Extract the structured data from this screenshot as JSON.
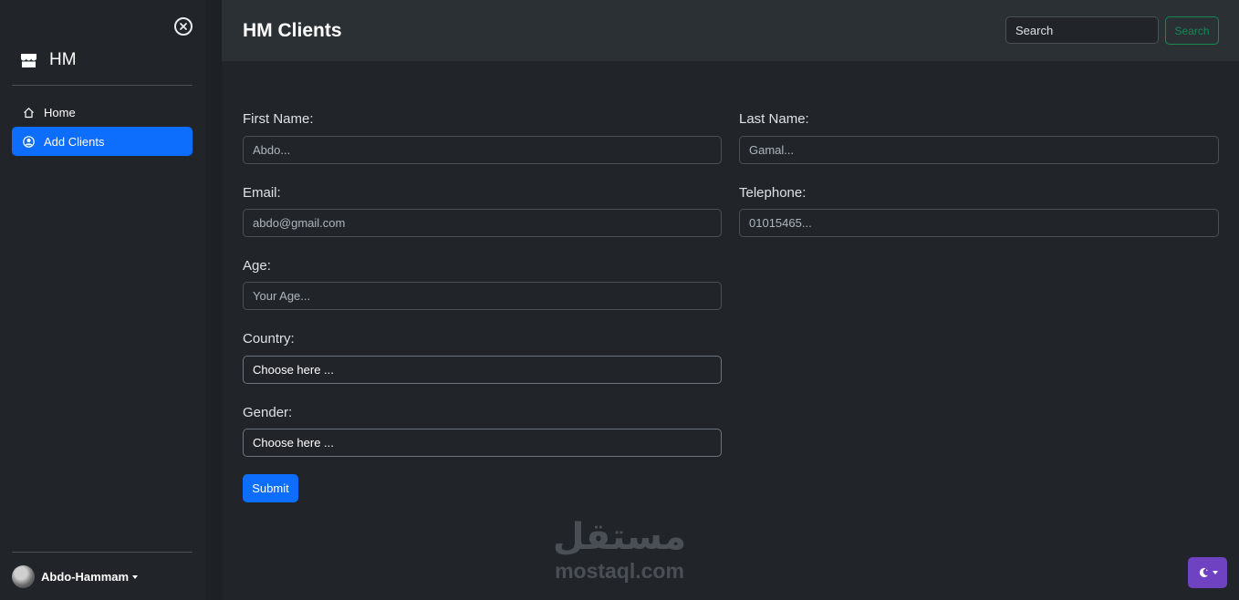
{
  "sidebar": {
    "brand": "HM",
    "nav": [
      {
        "label": "Home",
        "icon": "home-icon"
      },
      {
        "label": "Add Clients",
        "icon": "person-circle-icon",
        "active": true
      }
    ],
    "user": {
      "name": "Abdo-Hammam"
    }
  },
  "header": {
    "title": "HM Clients",
    "search_placeholder": "Search",
    "search_button": "Search"
  },
  "form": {
    "first_name": {
      "label": "First Name:",
      "placeholder": "Abdo..."
    },
    "last_name": {
      "label": "Last Name:",
      "placeholder": "Gamal..."
    },
    "email": {
      "label": "Email:",
      "placeholder": "abdo@gmail.com"
    },
    "telephone": {
      "label": "Telephone:",
      "placeholder": "01015465..."
    },
    "age": {
      "label": "Age:",
      "placeholder": "Your Age..."
    },
    "country": {
      "label": "Country:",
      "selected": "Choose here ..."
    },
    "gender": {
      "label": "Gender:",
      "selected": "Choose here ..."
    },
    "submit": "Submit"
  },
  "watermark": {
    "arabic": "مستقل",
    "latin": "mostaql.com"
  },
  "colors": {
    "primary": "#0d6efd",
    "success": "#198754",
    "theme_toggle": "#6f42c1"
  }
}
